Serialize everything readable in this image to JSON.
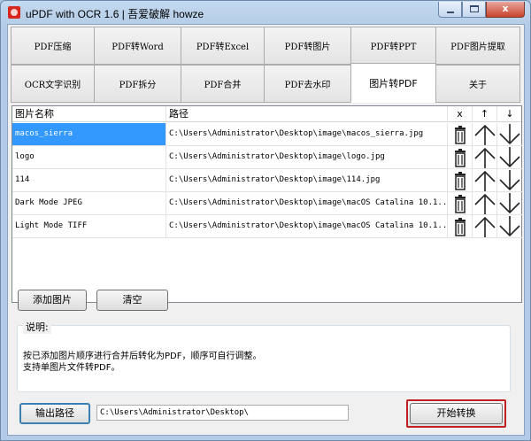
{
  "window": {
    "title": "uPDF with OCR 1.6 |  吾爱破解 howze",
    "min_glyph": "–",
    "max_glyph": "□",
    "close_glyph": "x"
  },
  "tabs_row1": [
    "PDF压缩",
    "PDF转Word",
    "PDF转Excel",
    "PDF转图片",
    "PDF转PPT",
    "PDF图片提取"
  ],
  "tabs_row2": [
    "OCR文字识别",
    "PDF拆分",
    "PDF合并",
    "PDF去水印",
    "图片转PDF",
    "关于"
  ],
  "active_tab": "图片转PDF",
  "list": {
    "columns": {
      "name": "图片名称",
      "path": "路径",
      "delete": "x",
      "up": "↑",
      "down": "↓"
    },
    "rows": [
      {
        "name": "macos_sierra",
        "path": "C:\\Users\\Administrator\\Desktop\\image\\macos_sierra.jpg"
      },
      {
        "name": "logo",
        "path": "C:\\Users\\Administrator\\Desktop\\image\\logo.jpg"
      },
      {
        "name": "114",
        "path": "C:\\Users\\Administrator\\Desktop\\image\\114.jpg"
      },
      {
        "name": "Dark Mode JPEG",
        "path": "C:\\Users\\Administrator\\Desktop\\image\\macOS Catalina 10.1..."
      },
      {
        "name": "Light Mode TIFF",
        "path": "C:\\Users\\Administrator\\Desktop\\image\\macOS Catalina 10.1..."
      }
    ]
  },
  "buttons": {
    "add_image": "添加图片",
    "clear": "清空",
    "output_path": "输出路径",
    "start": "开始转换"
  },
  "notes": {
    "legend": "说明:",
    "line1": "按已添加图片顺序进行合并后转化为PDF，顺序可自行调整。",
    "line2": "支持单图片文件转PDF。"
  },
  "output_path_value": "C:\\Users\\Administrator\\Desktop\\",
  "colors": {
    "selection": "#3399ff",
    "start_border": "#c02020",
    "title_bar": "#b3cbe6"
  },
  "icons": {
    "delete": "trash-icon",
    "up": "arrow-up-icon",
    "down": "arrow-down-icon"
  }
}
